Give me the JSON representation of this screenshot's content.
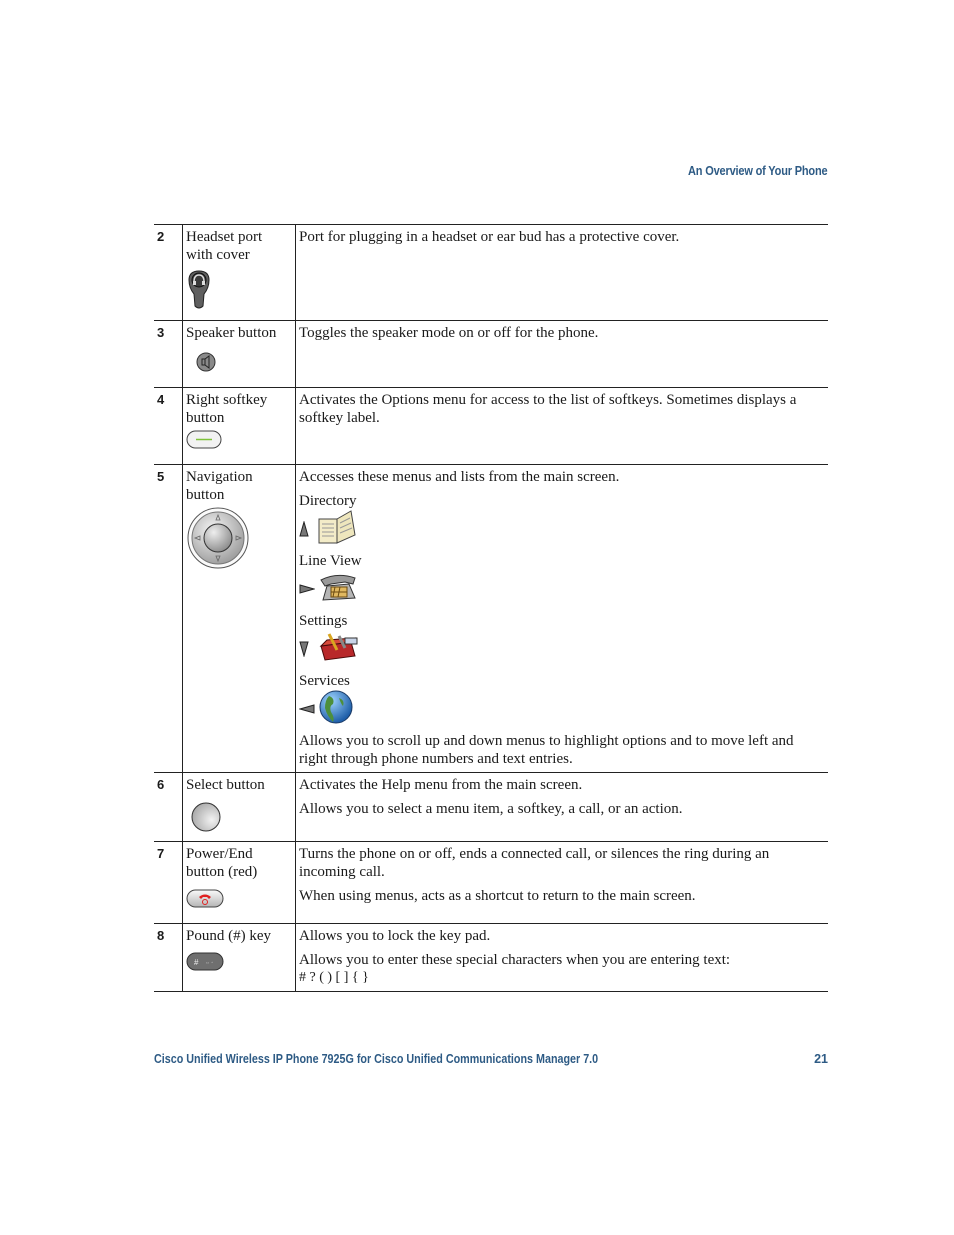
{
  "header": {
    "section_title": "An Overview of Your Phone"
  },
  "table": {
    "rows": [
      {
        "number": "2",
        "feature": "Headset port with cover",
        "icon": "headset-port-icon",
        "description": [
          "Port for plugging in a headset or ear bud has a protective cover."
        ]
      },
      {
        "number": "3",
        "feature": "Speaker button",
        "icon": "speaker-button-icon",
        "description": [
          "Toggles the speaker mode on or off for the phone."
        ]
      },
      {
        "number": "4",
        "feature": "Right softkey button",
        "icon": "softkey-button-icon",
        "description": [
          "Activates the Options menu for access to the list of softkeys. Sometimes displays a softkey label."
        ]
      },
      {
        "number": "5",
        "feature": "Navigation button",
        "icon": "navigation-button-icon",
        "description_intro": "Accesses these menus and lists from the main screen.",
        "menus": [
          {
            "label": "Directory",
            "arrow": "up",
            "icon": "directory-book-icon"
          },
          {
            "label": "Line View",
            "arrow": "right",
            "icon": "line-view-phone-icon"
          },
          {
            "label": "Settings",
            "arrow": "down",
            "icon": "settings-toolbox-icon"
          },
          {
            "label": "Services",
            "arrow": "left",
            "icon": "services-globe-icon"
          }
        ],
        "description_outro": "Allows you to scroll up and down menus to highlight options and to move left and right through phone numbers and text entries."
      },
      {
        "number": "6",
        "feature": "Select button",
        "icon": "select-button-icon",
        "description": [
          "Activates the Help menu from the main screen.",
          "Allows you to select a menu item, a softkey, a call, or an action."
        ]
      },
      {
        "number": "7",
        "feature": "Power/End button (red)",
        "icon": "power-end-button-icon",
        "description": [
          "Turns the phone on or off, ends a connected call, or silences the ring during an incoming call.",
          "When using menus, acts as a shortcut to return to the main screen."
        ]
      },
      {
        "number": "8",
        "feature": "Pound (#) key",
        "icon": "pound-key-icon",
        "description": [
          "Allows you to lock the key pad.",
          "Allows you to enter these special characters when you are entering text:"
        ],
        "special_chars": "# ? ( ) [ ] { }"
      }
    ]
  },
  "footer": {
    "doc_title": "Cisco Unified Wireless IP Phone 7925G for Cisco Unified Communications Manager 7.0",
    "page_number": "21"
  },
  "colors": {
    "heading_blue": "#2e5b85"
  }
}
